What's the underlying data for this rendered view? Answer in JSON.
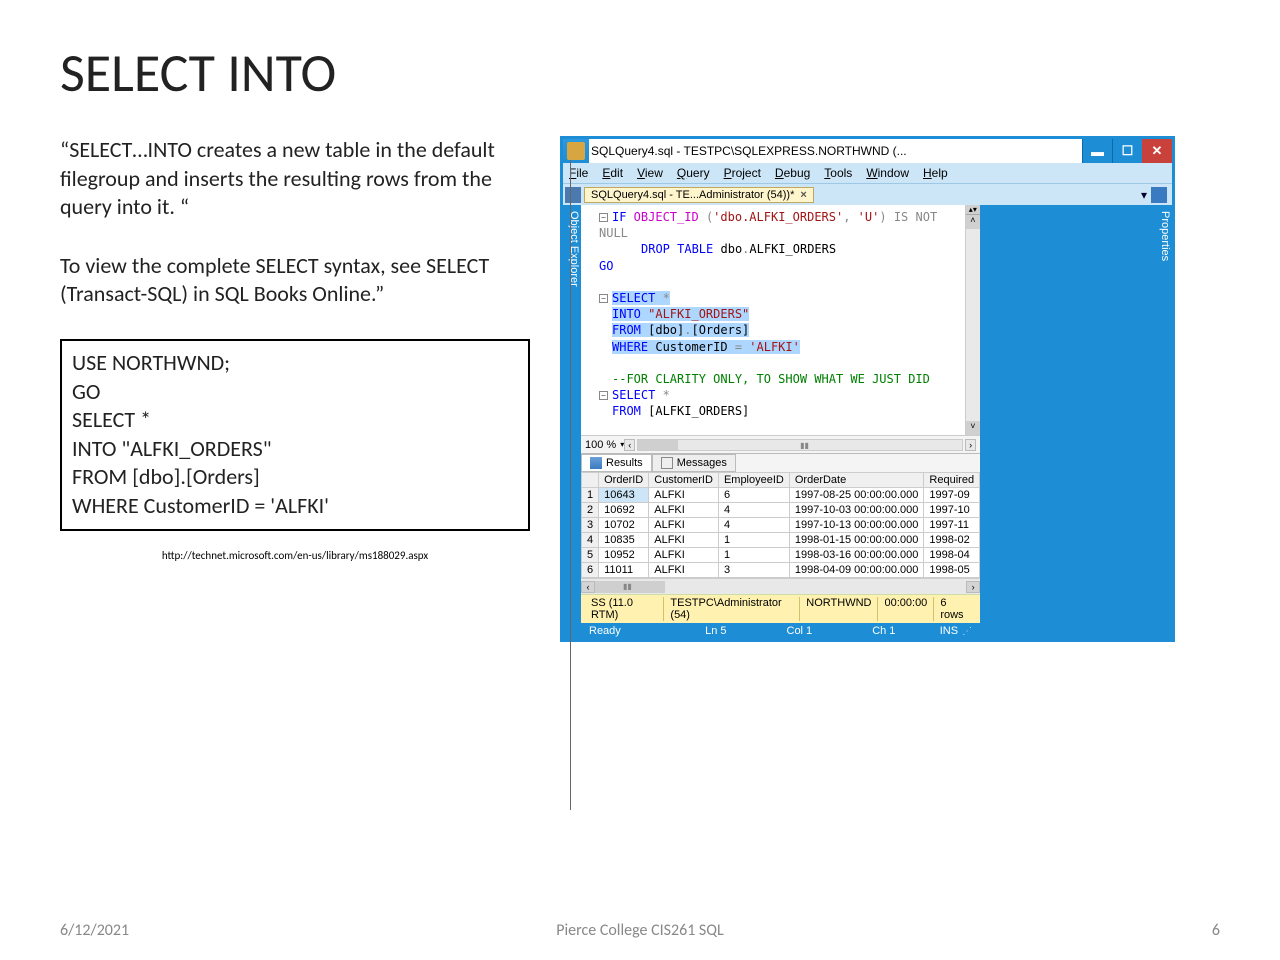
{
  "slide": {
    "title": "SELECT INTO",
    "para1": "“SELECT…INTO creates a new table in the default filegroup and inserts the resulting rows from the query into it. “",
    "para2": "To view the complete SELECT syntax, see SELECT (Transact-SQL) in SQL Books Online.”",
    "code": "USE NORTHWND;\nGO\nSELECT *\nINTO \"ALFKI_ORDERS\"\nFROM [dbo].[Orders]\nWHERE CustomerID = 'ALFKI'",
    "source": "http://technet.microsoft.com/en-us/library/ms188029.aspx"
  },
  "footer": {
    "date": "6/12/2021",
    "course": "Pierce College CIS261 SQL",
    "page": "6"
  },
  "ssms": {
    "title": "SQLQuery4.sql - TESTPC\\SQLEXPRESS.NORTHWND (...",
    "menu": [
      "File",
      "Edit",
      "View",
      "Query",
      "Project",
      "Debug",
      "Tools",
      "Window",
      "Help"
    ],
    "tab": "SQLQuery4.sql - TE...Administrator (54))*",
    "sidetabs": {
      "left": "Object Explorer",
      "right": "Properties"
    },
    "zoom": "100 %",
    "resultTabs": {
      "results": "Results",
      "messages": "Messages"
    },
    "columns": [
      "",
      "OrderID",
      "CustomerID",
      "EmployeeID",
      "OrderDate",
      "Required"
    ],
    "rows": [
      [
        "1",
        "10643",
        "ALFKI",
        "6",
        "1997-08-25 00:00:00.000",
        "1997-09"
      ],
      [
        "2",
        "10692",
        "ALFKI",
        "4",
        "1997-10-03 00:00:00.000",
        "1997-10"
      ],
      [
        "3",
        "10702",
        "ALFKI",
        "4",
        "1997-10-13 00:00:00.000",
        "1997-11"
      ],
      [
        "4",
        "10835",
        "ALFKI",
        "1",
        "1998-01-15 00:00:00.000",
        "1998-02"
      ],
      [
        "5",
        "10952",
        "ALFKI",
        "1",
        "1998-03-16 00:00:00.000",
        "1998-04"
      ],
      [
        "6",
        "11011",
        "ALFKI",
        "3",
        "1998-04-09 00:00:00.000",
        "1998-05"
      ]
    ],
    "status": {
      "ver": "SS (11.0 RTM)",
      "user": "TESTPC\\Administrator (54)",
      "db": "NORTHWND",
      "time": "00:00:00",
      "rows": "6 rows"
    },
    "bottom": {
      "ready": "Ready",
      "ln": "Ln 5",
      "col": "Col 1",
      "ch": "Ch 1",
      "ins": "INS"
    },
    "sql": {
      "l1a": "IF",
      "l1b": " OBJECT_ID ",
      "l1c": "(",
      "l1d": "'dbo.ALFKI_ORDERS'",
      "l1e": ",",
      "l1f": " 'U'",
      "l1g": ")",
      "l1h": " IS NOT NULL",
      "l2a": "DROP",
      "l2b": " TABLE",
      "l2c": " dbo",
      "l2d": ".",
      "l2e": "ALFKI_ORDERS",
      "l3": "GO",
      "l5a": "SELECT",
      "l5b": " *",
      "l6a": "INTO ",
      "l6b": "\"ALFKI_ORDERS\"",
      "l7a": "FROM ",
      "l7b": "[dbo]",
      "l7c": ".",
      "l7d": "[Orders]",
      "l8a": "WHERE",
      "l8b": " CustomerID ",
      "l8c": "=",
      "l8d": " 'ALFKI'",
      "l10": "--FOR CLARITY ONLY, TO SHOW WHAT WE JUST DID",
      "l11a": "SELECT",
      "l11b": " *",
      "l12a": "FROM ",
      "l12b": "[ALFKI_ORDERS]"
    }
  }
}
